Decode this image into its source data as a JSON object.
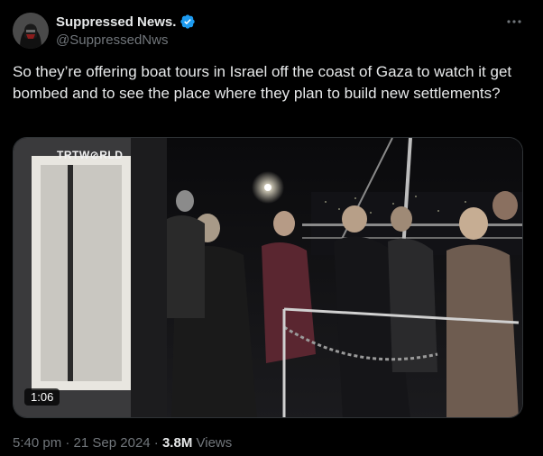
{
  "author": {
    "display_name": "Suppressed News.",
    "handle": "@SuppressedNws",
    "verified": true,
    "verified_color": "#1d9bf0",
    "avatar_icon": "masked-figure-avatar"
  },
  "tweet": {
    "text": "So they’re offering boat tours in Israel off the coast of Gaza to watch it get bombed and to see the place where they plan to build new settlements?"
  },
  "media": {
    "type": "video",
    "watermark": "TRTW⊘RLD",
    "duration": "1:06"
  },
  "meta": {
    "time": "5:40 pm",
    "separator": "·",
    "date": "21 Sep 2024",
    "views_count": "3.8M",
    "views_label": "Views"
  },
  "colors": {
    "background": "#000000",
    "text": "#e7e9ea",
    "secondary": "#71767b",
    "border": "#2f3336"
  }
}
